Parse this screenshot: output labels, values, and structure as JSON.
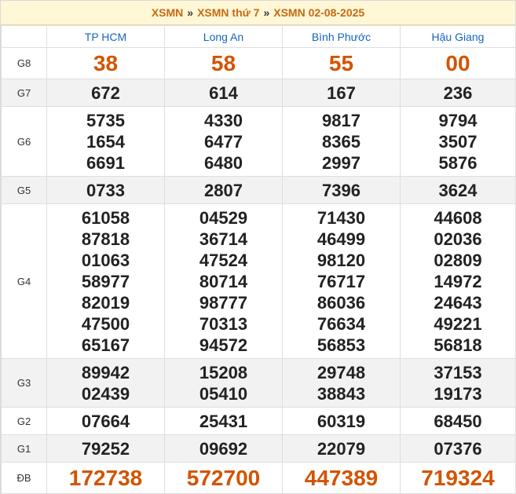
{
  "breadcrumb": {
    "items": [
      "XSMN",
      "XSMN thứ 7",
      "XSMN 02-08-2025"
    ],
    "separator": "»"
  },
  "provinces": [
    "TP HCM",
    "Long An",
    "Bình Phước",
    "Hậu Giang"
  ],
  "prizes": [
    {
      "label": "G8",
      "values": [
        [
          "38"
        ],
        [
          "58"
        ],
        [
          "55"
        ],
        [
          "00"
        ]
      ]
    },
    {
      "label": "G7",
      "values": [
        [
          "672"
        ],
        [
          "614"
        ],
        [
          "167"
        ],
        [
          "236"
        ]
      ]
    },
    {
      "label": "G6",
      "values": [
        [
          "5735",
          "1654",
          "6691"
        ],
        [
          "4330",
          "6477",
          "6480"
        ],
        [
          "9817",
          "8365",
          "2997"
        ],
        [
          "9794",
          "3507",
          "5876"
        ]
      ]
    },
    {
      "label": "G5",
      "values": [
        [
          "0733"
        ],
        [
          "2807"
        ],
        [
          "7396"
        ],
        [
          "3624"
        ]
      ]
    },
    {
      "label": "G4",
      "values": [
        [
          "61058",
          "87818",
          "01063",
          "58977",
          "82019",
          "47500",
          "65167"
        ],
        [
          "04529",
          "36714",
          "47524",
          "80714",
          "98777",
          "70313",
          "94572"
        ],
        [
          "71430",
          "46499",
          "98120",
          "76717",
          "86036",
          "76634",
          "56853"
        ],
        [
          "44608",
          "02036",
          "02809",
          "14972",
          "24643",
          "49221",
          "56818"
        ]
      ]
    },
    {
      "label": "G3",
      "values": [
        [
          "89942",
          "02439"
        ],
        [
          "15208",
          "05410"
        ],
        [
          "29748",
          "38843"
        ],
        [
          "37153",
          "19173"
        ]
      ]
    },
    {
      "label": "G2",
      "values": [
        [
          "07664"
        ],
        [
          "25431"
        ],
        [
          "60319"
        ],
        [
          "68450"
        ]
      ]
    },
    {
      "label": "G1",
      "values": [
        [
          "79252"
        ],
        [
          "09692"
        ],
        [
          "22079"
        ],
        [
          "07376"
        ]
      ]
    },
    {
      "label": "ĐB",
      "values": [
        [
          "172738"
        ],
        [
          "572700"
        ],
        [
          "447389"
        ],
        [
          "719324"
        ]
      ]
    }
  ],
  "colors": {
    "accent": "#d35400",
    "header_link": "#1565c0",
    "crumb_bg": "#fff7d6"
  }
}
